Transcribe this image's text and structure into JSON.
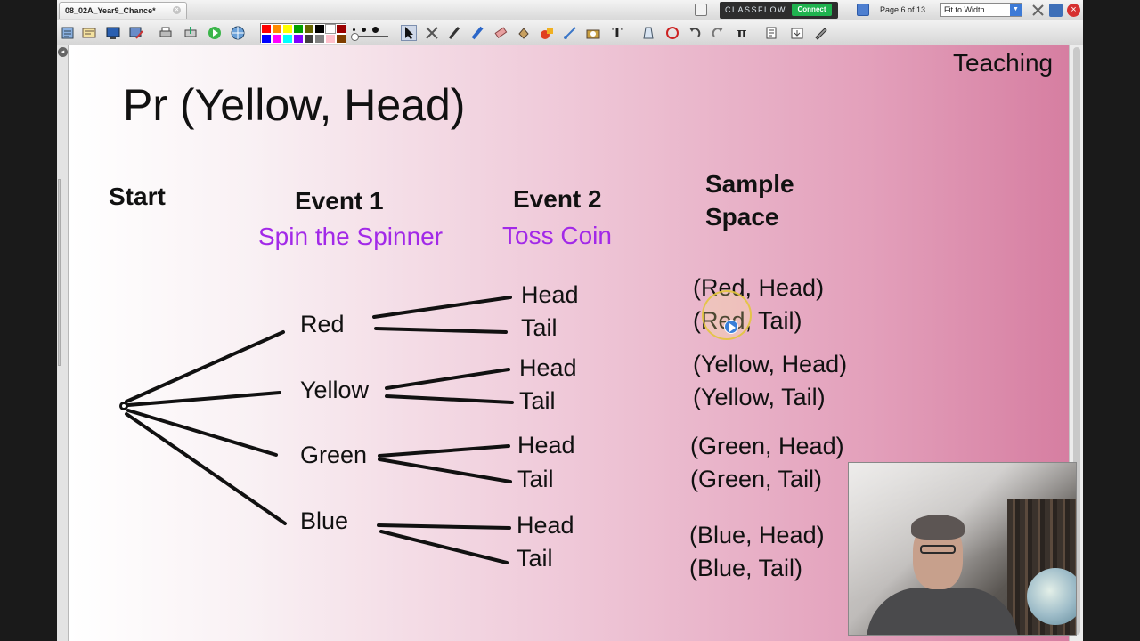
{
  "window": {
    "tab_title": "08_02A_Year9_Chance*",
    "tab_close_icon": "close-circle-icon"
  },
  "classflow": {
    "label": "CLASSFLOW",
    "connect_label": "Connect",
    "connect_color": "#1fb34f"
  },
  "navigation": {
    "page_indicator": "Page 6 of 13",
    "zoom_value": "Fit to Width"
  },
  "toolbar": {
    "tools": [
      "page-sorter-icon",
      "browser-icon",
      "desktop-icon",
      "annotate-icon",
      "print-icon",
      "export-icon",
      "play-icon",
      "web-icon",
      "select-icon",
      "magic-tools-icon",
      "pen-icon",
      "highlighter-icon",
      "eraser-icon",
      "fill-icon",
      "shape-icon",
      "connector-icon",
      "camera-icon",
      "text-icon",
      "clear-icon",
      "reset-icon",
      "undo-icon",
      "redo-icon",
      "pi-icon",
      "notes-icon",
      "download-icon",
      "edit-icon"
    ],
    "text_tool_label": "T",
    "pi_tool_label": "π",
    "colors": [
      "#ff0000",
      "#ff8c00",
      "#ffff00",
      "#00a000",
      "#666600",
      "#000000",
      "#ffffff",
      "#9b0000",
      "#0000ff",
      "#ff00ff",
      "#00ffff",
      "#8000ff",
      "#404040",
      "#808080",
      "#ffc0cb",
      "#7f3f00"
    ]
  },
  "slide": {
    "corner_label": "Teaching",
    "title": "Pr (Yellow, Head)",
    "headers": {
      "start": "Start",
      "event1": "Event 1",
      "event1_sub": "Spin the Spinner",
      "event2": "Event 2",
      "event2_sub": "Toss Coin",
      "sample_space_line1": "Sample",
      "sample_space_line2": "Space"
    },
    "subtitle_color": "#a229e8",
    "events": [
      {
        "label": "Red",
        "outcomes": [
          "Head",
          "Tail"
        ],
        "sample_space": [
          "(Red, Head)",
          "(Red, Tail)"
        ]
      },
      {
        "label": "Yellow",
        "outcomes": [
          "Head",
          "Tail"
        ],
        "sample_space": [
          "(Yellow, Head)",
          "(Yellow, Tail)"
        ]
      },
      {
        "label": "Green",
        "outcomes": [
          "Head",
          "Tail"
        ],
        "sample_space": [
          "(Green, Head)",
          "(Green, Tail)"
        ]
      },
      {
        "label": "Blue",
        "outcomes": [
          "Head",
          "Tail"
        ],
        "sample_space": [
          "(Blue, Head)",
          "(Blue, Tail)"
        ]
      }
    ]
  },
  "webcam": {
    "description_icon": "presenter-video-icon"
  }
}
